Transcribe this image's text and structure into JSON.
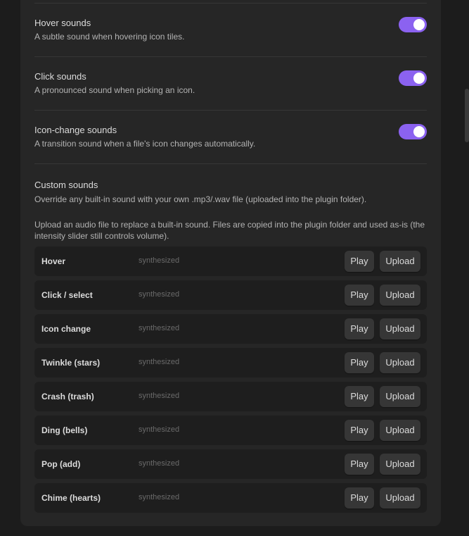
{
  "settings": [
    {
      "title": "Hover sounds",
      "description": "A subtle sound when hovering icon tiles.",
      "enabled": true
    },
    {
      "title": "Click sounds",
      "description": "A pronounced sound when picking an icon.",
      "enabled": true
    },
    {
      "title": "Icon-change sounds",
      "description": "A transition sound when a file's icon changes automatically.",
      "enabled": true
    }
  ],
  "custom_sounds": {
    "heading": "Custom sounds",
    "description": "Override any built-in sound with your own .mp3/.wav file (uploaded into the plugin folder).",
    "info": "Upload an audio file to replace a built-in sound. Files are copied into the plugin folder and used as-is (the intensity slider still controls volume).",
    "play_label": "Play",
    "upload_label": "Upload",
    "rows": [
      {
        "name": "Hover",
        "status": "synthesized"
      },
      {
        "name": "Click / select",
        "status": "synthesized"
      },
      {
        "name": "Icon change",
        "status": "synthesized"
      },
      {
        "name": "Twinkle (stars)",
        "status": "synthesized"
      },
      {
        "name": "Crash (trash)",
        "status": "synthesized"
      },
      {
        "name": "Ding (bells)",
        "status": "synthesized"
      },
      {
        "name": "Pop (add)",
        "status": "synthesized"
      },
      {
        "name": "Chime (hearts)",
        "status": "synthesized"
      }
    ]
  },
  "colors": {
    "accent": "#8b62f0",
    "background": "#1c1c1c",
    "panel": "#262626",
    "row": "#1e1e1e",
    "button": "#363636"
  }
}
